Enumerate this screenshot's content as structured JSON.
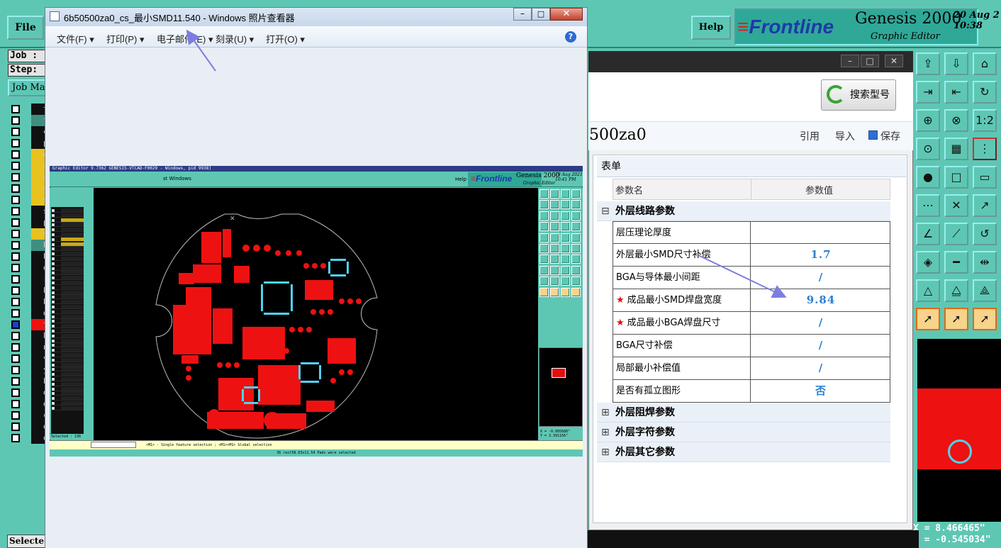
{
  "genesis": {
    "file_menu": "File",
    "help_menu": "Help",
    "logo_text": "Frontline",
    "title": "Genesis 2000",
    "subtitle": "Graphic Editor",
    "date": "20 Aug 2",
    "time": "10:38 ",
    "job_field": "Job :",
    "step_field": "Step:",
    "job_menu": "Job Ma",
    "layers": [
      "to",
      "ts",
      "cs",
      "pl",
      "cs",
      "si",
      "si",
      "si",
      "si",
      "ss",
      "pl",
      "ss",
      "bs",
      "bo",
      "dr",
      "ro",
      "bo",
      "bp",
      "do",
      "ty",
      "hy",
      "np",
      "v-",
      "yc",
      "bi",
      "da",
      "d ",
      "cv",
      "dv",
      "dw"
    ],
    "selected_label": "Selecte",
    "coord_x": "X = 8.466465\"",
    "coord_y": "Y = -0.545034\""
  },
  "param_window": {
    "search_button": "搜索型号",
    "part_code": "500za0",
    "actions": {
      "quote": "引用",
      "import": "导入",
      "save": "保存"
    },
    "form_title": "表单",
    "col_name": "参数名",
    "col_value": "参数值",
    "groups": {
      "outer_circuit": "外层线路参数",
      "outer_mask": "外层阻焊参数",
      "outer_silk": "外层字符参数",
      "outer_other": "外层其它参数"
    },
    "rows": [
      {
        "name": "层压理论厚度",
        "value": "",
        "required": false
      },
      {
        "name": "外层最小SMD尺寸补偿",
        "value": "1.7",
        "required": false
      },
      {
        "name": "BGA与导体最小间距",
        "value": "/",
        "required": false
      },
      {
        "name": "成品最小SMD焊盘宽度",
        "value": "9.84",
        "required": true
      },
      {
        "name": "成品最小BGA焊盘尺寸",
        "value": "/",
        "required": true
      },
      {
        "name": "BGA尺寸补偿",
        "value": "/",
        "required": false
      },
      {
        "name": "局部最小补偿值",
        "value": "/",
        "required": false
      },
      {
        "name": "是否有孤立图形",
        "value": "否",
        "required": false
      }
    ],
    "star_glyph": "★",
    "minus_glyph": "⊟",
    "plus_glyph": "⊞"
  },
  "viewer": {
    "title": "6b50500za0_cs_最小SMD11.540 - Windows 照片查看器",
    "menus": [
      "文件(F)",
      "打印(P)",
      "电子邮件(E)",
      "刻录(U)",
      "打开(O)"
    ],
    "help": "?",
    "min": "–",
    "max": "□",
    "close": "✕"
  },
  "screenshot": {
    "title": "Graphic Editor 9.7362 GENESIS-VTCAD-F0029 - Windows, pid 9938]",
    "menu": "st        Windows",
    "help": "Help",
    "logo_text": "Frontline",
    "genesis": "Genesis 2000",
    "subtitle": "Graphic Editor",
    "date": "19 Aug 2021",
    "time": "10:41 PM",
    "selected": "Selected : 136",
    "status": "<M1> - Single feature selection ; <M1><M1> Global selection",
    "bottom": "36 rect58.63x11.54 Pads were selected",
    "coords_x": "X = -0.005680\"",
    "coords_y": "Y = 3.391156\""
  },
  "colors": {
    "teal": "#5ec7b4",
    "pcb_red": "#ee1111",
    "pad_cyan": "#4fd3f0",
    "value_blue": "#2b7fd2",
    "arrow": "#7d7de0"
  }
}
